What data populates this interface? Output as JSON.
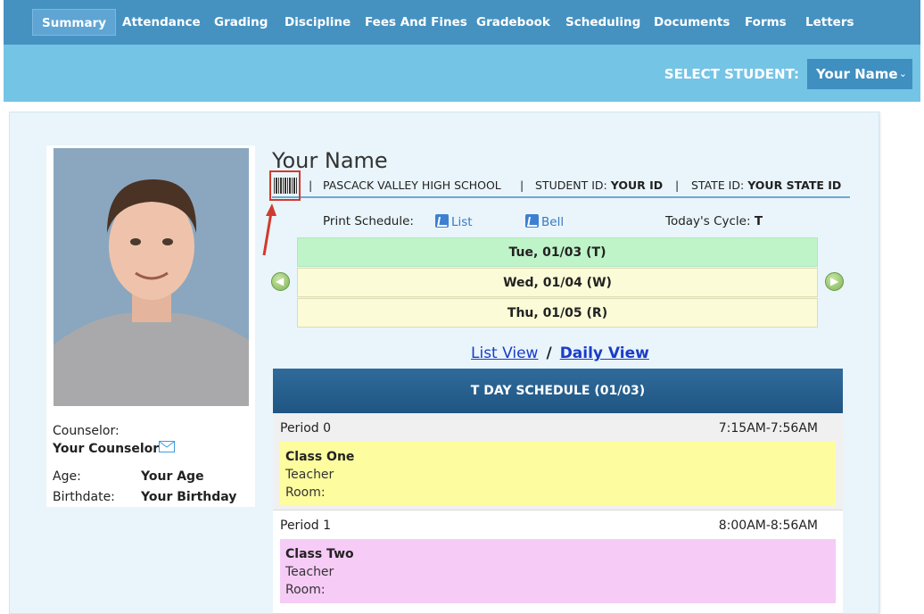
{
  "nav": {
    "tabs": [
      "Summary",
      "Attendance",
      "Grading",
      "Discipline",
      "Fees And Fines",
      "Gradebook",
      "Scheduling",
      "Documents",
      "Forms",
      "Letters"
    ],
    "active": "Summary"
  },
  "select_student": {
    "label": "SELECT STUDENT:",
    "value": "Your Name"
  },
  "profile": {
    "counselor_label": "Counselor:",
    "counselor_value": "Your Counselor",
    "age_label": "Age:",
    "age_value": "Your Age",
    "birthdate_label": "Birthdate:",
    "birthdate_value": "Your Birthday"
  },
  "header": {
    "student_name": "Your Name",
    "school": "PASCACK VALLEY HIGH SCHOOL",
    "student_id_label": "STUDENT ID:",
    "student_id_value": "YOUR ID",
    "state_id_label": "STATE ID:",
    "state_id_value": "YOUR STATE ID",
    "separator": "|"
  },
  "print_schedule": {
    "label": "Print Schedule:",
    "list_link": "List",
    "bell_link": "Bell",
    "cycle_label": "Today's Cycle:",
    "cycle_value": "T"
  },
  "dates": [
    "Tue, 01/03 (T)",
    "Wed, 01/04 (W)",
    "Thu, 01/05 (R)"
  ],
  "views": {
    "list_view": "List View",
    "separator": "/",
    "daily_view": "Daily View"
  },
  "schedule": {
    "title": "T DAY SCHEDULE (01/03)",
    "periods": [
      {
        "name": "Period 0",
        "time": "7:15AM-7:56AM",
        "class": "Class One",
        "teacher": "Teacher",
        "room": "Room:",
        "color": "#fdfd9f"
      },
      {
        "name": "Period 1",
        "time": "8:00AM-8:56AM",
        "class": "Class Two",
        "teacher": "Teacher",
        "room": "Room:",
        "color": "#f6ccf6"
      }
    ]
  },
  "colors": {
    "nav_bg": "#4592c1",
    "band_bg": "#74c4e6",
    "panel_bg": "#e9f5fb",
    "today_row": "#bff3c8",
    "other_row": "#fbfbd8",
    "schedule_header": "#1f5583",
    "highlight_box": "#d13a2d"
  }
}
